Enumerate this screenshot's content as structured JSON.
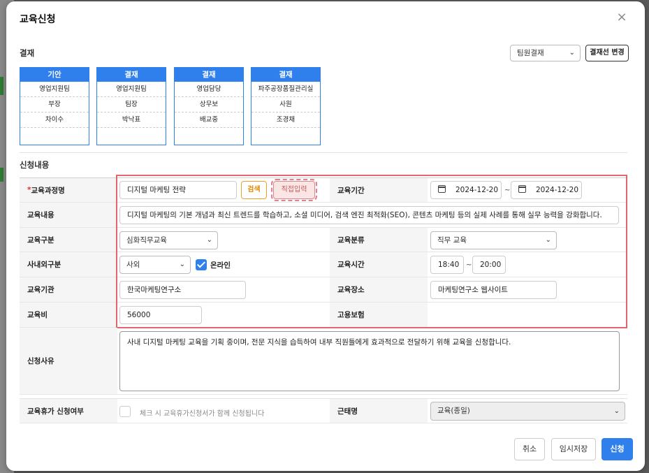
{
  "modal": {
    "title": "교육신청",
    "close_icon": "×"
  },
  "approval": {
    "section_label": "결재",
    "select_value": "팀원결재",
    "change_button": "결재선 변경",
    "boxes": [
      {
        "head": "기안",
        "dept": "영업지원팀",
        "title": "부장",
        "name": "차이수"
      },
      {
        "head": "결재",
        "dept": "영업지원팀",
        "title": "팀장",
        "name": "박낙표"
      },
      {
        "head": "결재",
        "dept": "영업담당",
        "title": "상무보",
        "name": "배교중"
      },
      {
        "head": "결재",
        "dept": "파주공장품질관리실",
        "title": "사원",
        "name": "조경채"
      }
    ]
  },
  "form": {
    "section_label": "신청내용",
    "course_name": {
      "label_mark": "*",
      "label": "교육과정명",
      "value": "디지털 마케팅 전략",
      "search_button": "검색",
      "direct_button": "직접입력"
    },
    "period": {
      "label": "교육기간",
      "start": "2024-12-20",
      "sep": "~",
      "end": "2024-12-20"
    },
    "content": {
      "label": "교육내용",
      "value": "디지털 마케팅의 기본 개념과 최신 트렌드를 학습하고, 소셜 미디어, 검색 엔진 최적화(SEO), 콘텐츠 마케팅 등의 실제 사례를 통해 실무 능력을 강화합니다."
    },
    "category": {
      "label": "교육구분",
      "value": "심화직무교육"
    },
    "classification": {
      "label": "교육분류",
      "value": "직무 교육"
    },
    "in_out": {
      "label": "사내외구분",
      "value": "사외",
      "online_label": "온라인",
      "online_checked": true
    },
    "time": {
      "label": "교육시간",
      "start": "18:40",
      "sep": "~",
      "end": "20:00"
    },
    "institution": {
      "label": "교육기관",
      "value": "한국마케팅연구소"
    },
    "place": {
      "label": "교육장소",
      "value": "마케팅연구소 웹사이트"
    },
    "cost": {
      "label": "교육비",
      "value": "56000"
    },
    "insurance": {
      "label": "고용보험"
    },
    "reason": {
      "label": "신청사유",
      "value": "사내 디지털 마케팅 교육을 기획 중이며, 전문 지식을 습득하여 내부 직원들에게 효과적으로 전달하기 위해 교육을 신청합니다."
    },
    "leave": {
      "label": "교육휴가 신청여부",
      "hint": "체크 시 교육휴가신청서가 함께 신청됩니다"
    },
    "attendance": {
      "label": "근태명",
      "value": "교육(종일)"
    }
  },
  "footer": {
    "cancel": "취소",
    "temp_save": "임시저장",
    "submit": "신청"
  },
  "colors": {
    "primary": "#2f80ed",
    "highlight": "#e06670",
    "search": "#f0a020"
  }
}
